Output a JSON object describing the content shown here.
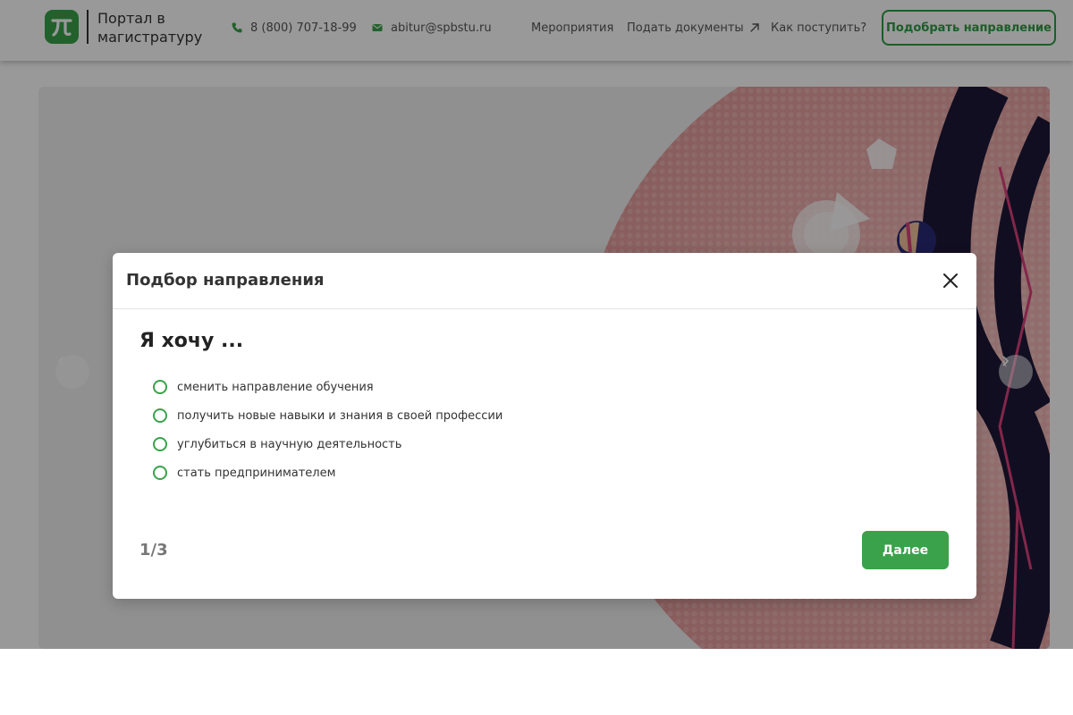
{
  "colors": {
    "brand_green": "#3aa24a",
    "overlay": "rgba(0,0,0,0.4)",
    "text_dark": "#333333"
  },
  "header": {
    "logo_text": "Портал в магистратуру",
    "phone": "8 (800) 707-18-99",
    "email": "abitur@spbstu.ru",
    "nav": [
      {
        "label": "Мероприятия"
      },
      {
        "label": "Подать документы",
        "icon": "arrow-up-right-icon"
      },
      {
        "label": "Как поступить?"
      }
    ],
    "cta_label": "Подобрать направление"
  },
  "hero": {
    "prev_icon": "chevron-left-icon",
    "next_icon": "chevron-right-icon"
  },
  "modal": {
    "title": "Подбор направления",
    "close_icon": "close-icon",
    "question": "Я хочу ...",
    "options": [
      {
        "label": "сменить направление обучения",
        "selected": false
      },
      {
        "label": "получить новые навыки и знания в своей профессии",
        "selected": false
      },
      {
        "label": "углубиться в научную деятельность",
        "selected": false
      },
      {
        "label": "стать предпринимателем",
        "selected": false
      }
    ],
    "step": "1/3",
    "next_label": "Далее"
  }
}
